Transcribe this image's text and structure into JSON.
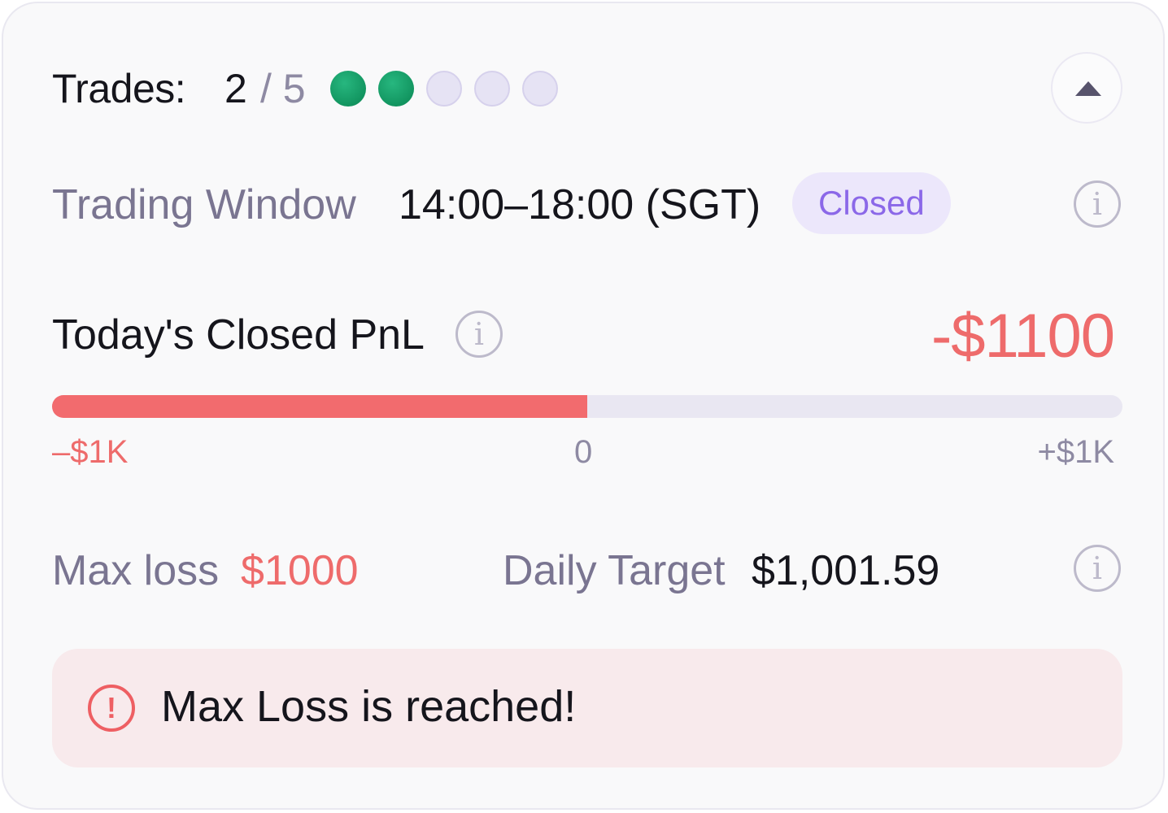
{
  "trades": {
    "label": "Trades:",
    "used": "2",
    "separator": "/ 5",
    "used_count": 2,
    "total_count": 5
  },
  "trading_window": {
    "label": "Trading Window",
    "time": "14:00–18:00 (SGT)",
    "status": "Closed"
  },
  "pnl": {
    "label": "Today's Closed PnL",
    "value": "-$1100",
    "bar_fill_fraction": 0.5,
    "tick_min": "–$1K",
    "tick_mid": "0",
    "tick_max": "+$1K"
  },
  "limits": {
    "max_loss_label": "Max loss",
    "max_loss_value": "$1000",
    "daily_target_label": "Daily Target",
    "daily_target_value": "$1,001.59"
  },
  "alert": {
    "text": "Max Loss is reached!"
  },
  "colors": {
    "loss": "#ee6b6b",
    "success": "#129560",
    "badge_bg": "#ece7fb",
    "badge_text": "#8b68e8",
    "alert_bg": "#f8eaec"
  },
  "icons": {
    "collapse": "chevron-up-icon",
    "info": "info-icon",
    "alert": "alert-circle-icon"
  }
}
